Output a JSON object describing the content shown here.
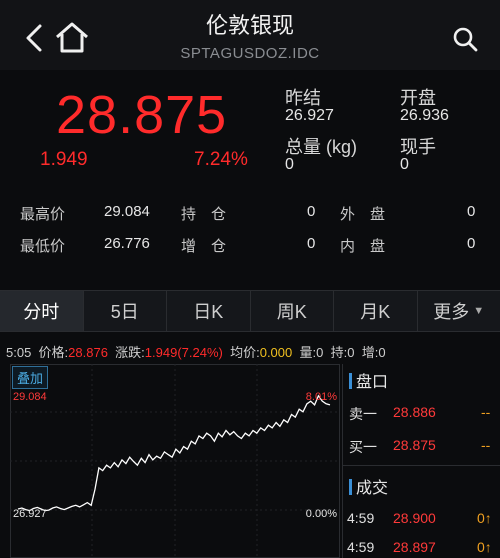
{
  "header": {
    "title": "伦敦银现",
    "subtitle": "SPTAGUSDOZ.IDC"
  },
  "quote": {
    "price": "28.875",
    "change": "1.949",
    "change_pct": "7.24%",
    "prev_close_label": "昨结",
    "prev_close": "26.927",
    "open_label": "开盘",
    "open": "26.936",
    "volume_label": "总量 (kg)",
    "volume": "0",
    "current_hand_label": "现手",
    "current_hand": "0",
    "high_label": "最高价",
    "high": "29.084",
    "low_label": "最低价",
    "low": "26.776",
    "position_label": "持　仓",
    "position": "0",
    "increase_label": "增　仓",
    "increase": "0",
    "outer_label": "外　盘",
    "outer": "0",
    "inner_label": "内　盘",
    "inner": "0"
  },
  "tabs": [
    "分时",
    "5日",
    "日K",
    "周K",
    "月K",
    "更多"
  ],
  "infoline": {
    "time": "5:05",
    "price_label": "价格:",
    "price": "28.876",
    "change_label": "涨跌:",
    "change": "1.949(7.24%)",
    "avg_label": "均价:",
    "avg": "0.000",
    "vol_label": "量:",
    "vol": "0",
    "hold_label": "持:",
    "hold": "0",
    "add_label": "增:",
    "add": "0"
  },
  "chart": {
    "overlay_label": "叠加",
    "top_left_label": "29.084",
    "top_right_label": "8.01%",
    "bottom_left_label": "26.927",
    "bottom_right_label": "0.00%"
  },
  "chart_data": {
    "type": "line",
    "ylim": [
      26.5,
      29.084
    ],
    "values": [
      26.93,
      26.95,
      26.92,
      26.9,
      26.94,
      26.96,
      26.93,
      26.9,
      26.91,
      26.95,
      26.97,
      26.94,
      26.92,
      26.95,
      26.98,
      27.0,
      26.97,
      27.01,
      27.05,
      27.0,
      27.3,
      27.7,
      27.65,
      27.75,
      27.7,
      27.8,
      27.72,
      27.85,
      27.78,
      27.9,
      27.82,
      27.75,
      27.88,
      27.8,
      27.95,
      27.85,
      27.92,
      27.88,
      28.0,
      27.95,
      27.9,
      28.05,
      27.98,
      28.1,
      28.05,
      28.2,
      28.15,
      28.3,
      28.25,
      28.35,
      28.3,
      28.2,
      28.35,
      28.28,
      28.4,
      28.32,
      28.38,
      28.3,
      28.25,
      28.35,
      28.3,
      28.4,
      28.35,
      28.45,
      28.4,
      28.5,
      28.45,
      28.55,
      28.48,
      28.6,
      28.55,
      28.7,
      28.65,
      28.8,
      28.75,
      28.9,
      28.95,
      28.88,
      29.05,
      28.95,
      28.9,
      28.88
    ]
  },
  "panel": {
    "book_title": "盘口",
    "sell_label": "卖一",
    "sell_price": "28.886",
    "sell_vol": "--",
    "buy_label": "买一",
    "buy_price": "28.875",
    "buy_vol": "--",
    "trades_title": "成交",
    "trades": [
      {
        "time": "4:59",
        "price": "28.900",
        "vol": "0↑"
      },
      {
        "time": "4:59",
        "price": "28.897",
        "vol": "0↑"
      }
    ]
  }
}
